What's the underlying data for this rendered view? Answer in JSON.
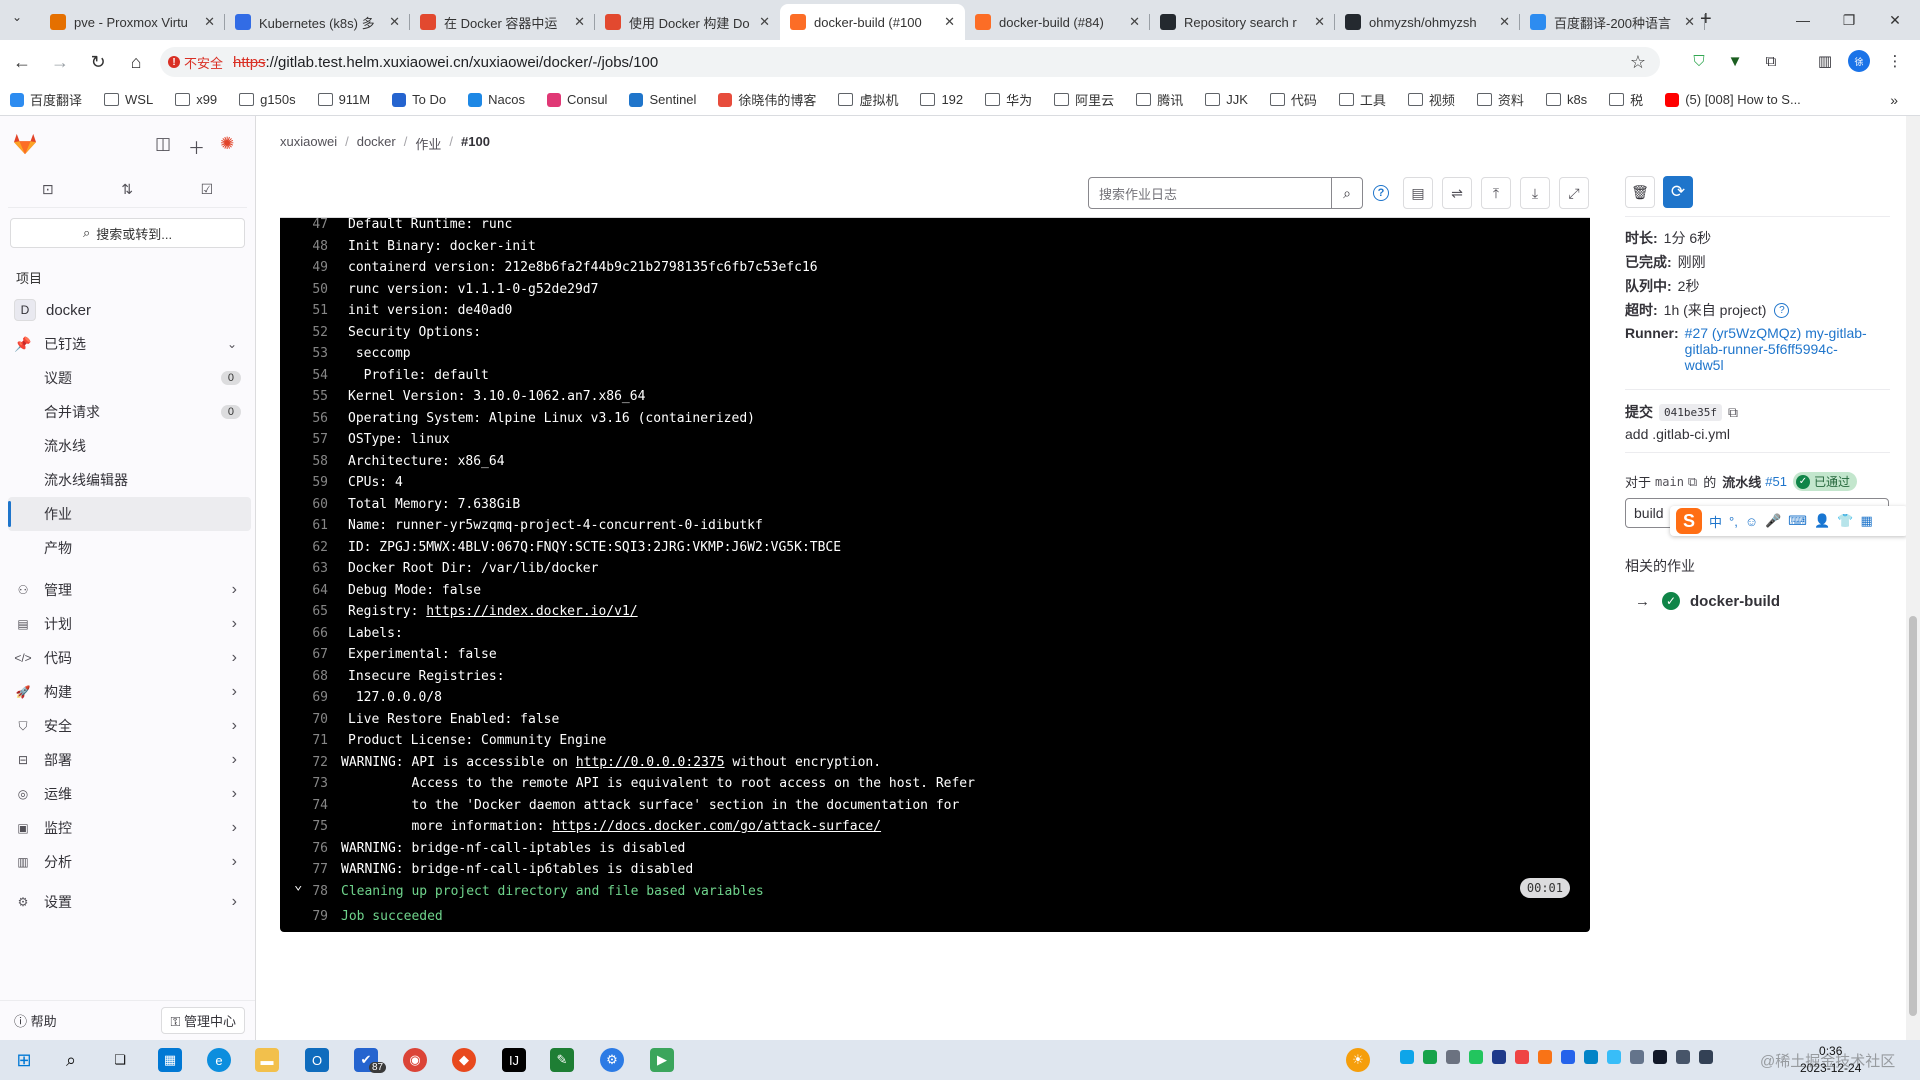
{
  "browser": {
    "tabs": [
      {
        "title": "pve - Proxmox Virtu",
        "color": "#e57000"
      },
      {
        "title": "Kubernetes (k8s) 多",
        "color": "#326ce5"
      },
      {
        "title": "在 Docker 容器中运",
        "color": "#e2492f"
      },
      {
        "title": "使用 Docker 构建 Do",
        "color": "#e2492f"
      },
      {
        "title": "docker-build (#100",
        "color": "#fc6d26"
      },
      {
        "title": "docker-build (#84)",
        "color": "#fc6d26"
      },
      {
        "title": "Repository search r",
        "color": "#24292f"
      },
      {
        "title": "ohmyzsh/ohmyzsh",
        "color": "#24292f"
      },
      {
        "title": "百度翻译-200种语言",
        "color": "#2d8cf0"
      }
    ],
    "active_tab": 4,
    "insecure_label": "不安全",
    "url_scheme": "https",
    "url_rest": "://gitlab.test.helm.xuxiaowei.cn/xuxiaowei/docker/-/jobs/100",
    "bookmarks": [
      {
        "label": "百度翻译",
        "kind": "app",
        "color": "#2d8cf0"
      },
      {
        "label": "WSL",
        "kind": "folder"
      },
      {
        "label": "x99",
        "kind": "folder"
      },
      {
        "label": "g150s",
        "kind": "folder"
      },
      {
        "label": "911M",
        "kind": "folder"
      },
      {
        "label": "To Do",
        "kind": "app",
        "color": "#2564cf"
      },
      {
        "label": "Nacos",
        "kind": "app",
        "color": "#1e88e5"
      },
      {
        "label": "Consul",
        "kind": "app",
        "color": "#e03875"
      },
      {
        "label": "Sentinel",
        "kind": "app",
        "color": "#1f75cb"
      },
      {
        "label": "徐晓伟的博客",
        "kind": "app",
        "color": "#e74c3c"
      },
      {
        "label": "虚拟机",
        "kind": "folder"
      },
      {
        "label": "192",
        "kind": "folder"
      },
      {
        "label": "华为",
        "kind": "folder"
      },
      {
        "label": "阿里云",
        "kind": "folder"
      },
      {
        "label": "腾讯",
        "kind": "folder"
      },
      {
        "label": "JJK",
        "kind": "folder"
      },
      {
        "label": "代码",
        "kind": "folder"
      },
      {
        "label": "工具",
        "kind": "folder"
      },
      {
        "label": "视频",
        "kind": "folder"
      },
      {
        "label": "资料",
        "kind": "folder"
      },
      {
        "label": "k8s",
        "kind": "folder"
      },
      {
        "label": "税",
        "kind": "folder"
      },
      {
        "label": "(5) [008] How to S...",
        "kind": "app",
        "color": "#ff0000"
      }
    ]
  },
  "sidebar": {
    "search_label": "搜索或转到...",
    "section_label": "项目",
    "project_initial": "D",
    "project_name": "docker",
    "pinned_label": "已钉选",
    "pinned_items": [
      {
        "label": "议题",
        "count": "0"
      },
      {
        "label": "合并请求",
        "count": "0"
      },
      {
        "label": "流水线"
      },
      {
        "label": "流水线编辑器"
      },
      {
        "label": "作业"
      },
      {
        "label": "产物"
      }
    ],
    "active_pinned": 4,
    "nav": [
      {
        "label": "管理",
        "icon": "manage-icon"
      },
      {
        "label": "计划",
        "icon": "plan-icon"
      },
      {
        "label": "代码",
        "icon": "code-icon"
      },
      {
        "label": "构建",
        "icon": "rocket-icon"
      },
      {
        "label": "安全",
        "icon": "shield-icon"
      },
      {
        "label": "部署",
        "icon": "deploy-icon"
      },
      {
        "label": "运维",
        "icon": "monitor-icon"
      },
      {
        "label": "监控",
        "icon": "chart-icon"
      },
      {
        "label": "分析",
        "icon": "analytics-icon"
      },
      {
        "label": "设置",
        "icon": "gear-icon"
      }
    ],
    "help_label": "帮助",
    "admin_label": "管理中心"
  },
  "breadcrumb": [
    "xuxiaowei",
    "docker",
    "作业",
    "#100"
  ],
  "log_toolbar": {
    "search_placeholder": "搜索作业日志"
  },
  "log": {
    "lines": [
      {
        "n": "47",
        "t": "Default Runtime: runc"
      },
      {
        "n": "48",
        "t": "Init Binary: docker-init"
      },
      {
        "n": "49",
        "t": "containerd version: 212e8b6fa2f44b9c21b2798135fc6fb7c53efc16"
      },
      {
        "n": "50",
        "t": "runc version: v1.1.1-0-g52de29d7"
      },
      {
        "n": "51",
        "t": "init version: de40ad0"
      },
      {
        "n": "52",
        "t": "Security Options:"
      },
      {
        "n": "53",
        "t": " seccomp"
      },
      {
        "n": "54",
        "t": "  Profile: default"
      },
      {
        "n": "55",
        "t": "Kernel Version: 3.10.0-1062.an7.x86_64"
      },
      {
        "n": "56",
        "t": "Operating System: Alpine Linux v3.16 (containerized)"
      },
      {
        "n": "57",
        "t": "OSType: linux"
      },
      {
        "n": "58",
        "t": "Architecture: x86_64"
      },
      {
        "n": "59",
        "t": "CPUs: 4"
      },
      {
        "n": "60",
        "t": "Total Memory: 7.638GiB"
      },
      {
        "n": "61",
        "t": "Name: runner-yr5wzqmq-project-4-concurrent-0-idibutkf"
      },
      {
        "n": "62",
        "t": "ID: ZPGJ:5MWX:4BLV:067Q:FNQY:SCTE:SQI3:2JRG:VKMP:J6W2:VG5K:TBCE"
      },
      {
        "n": "63",
        "t": "Docker Root Dir: /var/lib/docker"
      },
      {
        "n": "64",
        "t": "Debug Mode: false"
      },
      {
        "n": "65",
        "t": "Registry: ",
        "link": "https://index.docker.io/v1/"
      },
      {
        "n": "66",
        "t": "Labels:"
      },
      {
        "n": "67",
        "t": "Experimental: false"
      },
      {
        "n": "68",
        "t": "Insecure Registries:"
      },
      {
        "n": "69",
        "t": " 127.0.0.0/8"
      },
      {
        "n": "70",
        "t": "Live Restore Enabled: false"
      },
      {
        "n": "71",
        "t": "Product License: Community Engine"
      },
      {
        "n": "72",
        "t": "WARNING: API is accessible on ",
        "link": "http://0.0.0.0:2375",
        "after": " without encryption.",
        "flush": true
      },
      {
        "n": "73",
        "t": "         Access to the remote API is equivalent to root access on the host. Refer",
        "flush": true
      },
      {
        "n": "74",
        "t": "         to the 'Docker daemon attack surface' section in the documentation for",
        "flush": true
      },
      {
        "n": "75",
        "t": "         more information: ",
        "link": "https://docs.docker.com/go/attack-surface/",
        "flush": true
      },
      {
        "n": "76",
        "t": "WARNING: bridge-nf-call-iptables is disabled",
        "flush": true
      },
      {
        "n": "77",
        "t": "WARNING: bridge-nf-call-ip6tables is disabled",
        "flush": true
      },
      {
        "n": "78",
        "t": "Cleaning up project directory and file based variables",
        "green": true,
        "flush": true
      },
      {
        "n": "79",
        "t": "Job succeeded",
        "green": true,
        "flush": true
      }
    ],
    "section_duration": "00:01"
  },
  "job": {
    "duration_label": "时长:",
    "duration": "1分 6秒",
    "finished_label": "已完成:",
    "finished": "刚刚",
    "queued_label": "队列中:",
    "queued": "2秒",
    "timeout_label": "超时:",
    "timeout": "1h (来自 project)",
    "runner_label": "Runner:",
    "runner_lines": [
      "#27 (yr5WzQMQz) my-gitlab-",
      "gitlab-runner-5f6ff5994c-",
      "wdw5l"
    ],
    "commit_label": "提交",
    "commit_sha": "041be35f",
    "commit_msg": "add .gitlab-ci.yml",
    "pipeline_for": "对于",
    "branch": "main",
    "pipeline_of": "的",
    "pipeline_label": "流水线",
    "pipeline_id": "#51",
    "pipeline_status": "已通过",
    "stage": "build",
    "related_label": "相关的作业",
    "related_job": "docker-build"
  },
  "ime_bar": [
    "中",
    "°,",
    "☺",
    "🎤",
    "⌨",
    "👤",
    "👕",
    "▦"
  ],
  "taskbar": {
    "badge": "87",
    "time": "0:36",
    "date": "2023-12-24"
  },
  "watermark": "@稀土掘金技术社区",
  "colors": {
    "gitlab_blue": "#1f75cb",
    "success_green": "#108548",
    "log_bg": "#000000"
  }
}
